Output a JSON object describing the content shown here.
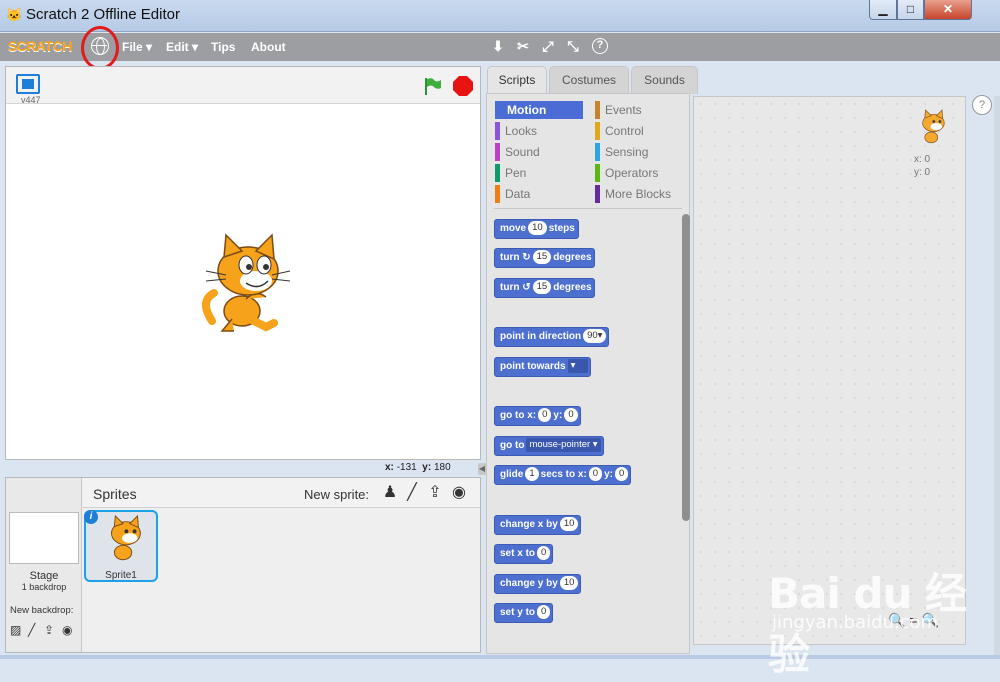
{
  "window": {
    "title": "Scratch 2 Offline Editor",
    "minimize": "▁",
    "maximize": "□",
    "close": "✕"
  },
  "menubar": {
    "logo": "SCRATCH",
    "file": "File ▾",
    "edit": "Edit ▾",
    "tips": "Tips",
    "about": "About"
  },
  "toolbar_icons": [
    "duplicate-icon",
    "cut-icon",
    "grow-icon",
    "shrink-icon",
    "help-icon"
  ],
  "stage": {
    "version": "v447",
    "coords_x_label": "x:",
    "coords_x": "-131",
    "coords_y_label": "y:",
    "coords_y": "180"
  },
  "sprites": {
    "title": "Sprites",
    "new_sprite_label": "New sprite:",
    "stage_label": "Stage",
    "backdrop_count": "1 backdrop",
    "new_backdrop_label": "New backdrop:",
    "sprite1_label": "Sprite1",
    "info_badge": "i"
  },
  "tabs": {
    "scripts": "Scripts",
    "costumes": "Costumes",
    "sounds": "Sounds"
  },
  "categories": [
    {
      "label": "Motion",
      "color": "#4a6cd4"
    },
    {
      "label": "Looks",
      "color": "#8a55d7"
    },
    {
      "label": "Sound",
      "color": "#bb42c3"
    },
    {
      "label": "Pen",
      "color": "#0e9a6c"
    },
    {
      "label": "Data",
      "color": "#ee7d16"
    },
    {
      "label": "Events",
      "color": "#c88330"
    },
    {
      "label": "Control",
      "color": "#e1a91a"
    },
    {
      "label": "Sensing",
      "color": "#2ca5e2"
    },
    {
      "label": "Operators",
      "color": "#5cb712"
    },
    {
      "label": "More Blocks",
      "color": "#632d99"
    }
  ],
  "blocks": {
    "move": {
      "a": "move",
      "v": "10",
      "b": "steps"
    },
    "turn_cw": {
      "a": "turn",
      "v": "15",
      "b": "degrees"
    },
    "turn_ccw": {
      "a": "turn",
      "v": "15",
      "b": "degrees"
    },
    "point_dir": {
      "a": "point in direction",
      "v": "90▾"
    },
    "point_towards": {
      "a": "point towards",
      "v": "▾"
    },
    "goto_xy": {
      "a": "go to x:",
      "x": "0",
      "b": "y:",
      "y": "0"
    },
    "goto": {
      "a": "go to",
      "v": "mouse-pointer ▾"
    },
    "glide": {
      "a": "glide",
      "v": "1",
      "b": "secs to x:",
      "x": "0",
      "c": "y:",
      "y": "0"
    },
    "change_x": {
      "a": "change x by",
      "v": "10"
    },
    "set_x": {
      "a": "set x to",
      "v": "0"
    },
    "change_y": {
      "a": "change y by",
      "v": "10"
    },
    "set_y": {
      "a": "set y to",
      "v": "0"
    }
  },
  "script_area": {
    "x_readout": "x: 0",
    "y_readout": "y: 0",
    "help": "?",
    "zoom": "🔍=🔍"
  },
  "watermark": {
    "main": "Bai du 经验",
    "sub": "jingyan.baidu.com"
  },
  "colors": {
    "accent_blue": "#1aa1e6",
    "menubar": "#9c9ea2",
    "block_blue": "#4c6fd0",
    "stop_red": "#e81313",
    "flag_green": "#2f8f3a",
    "annotation_red": "#e01b1b"
  }
}
